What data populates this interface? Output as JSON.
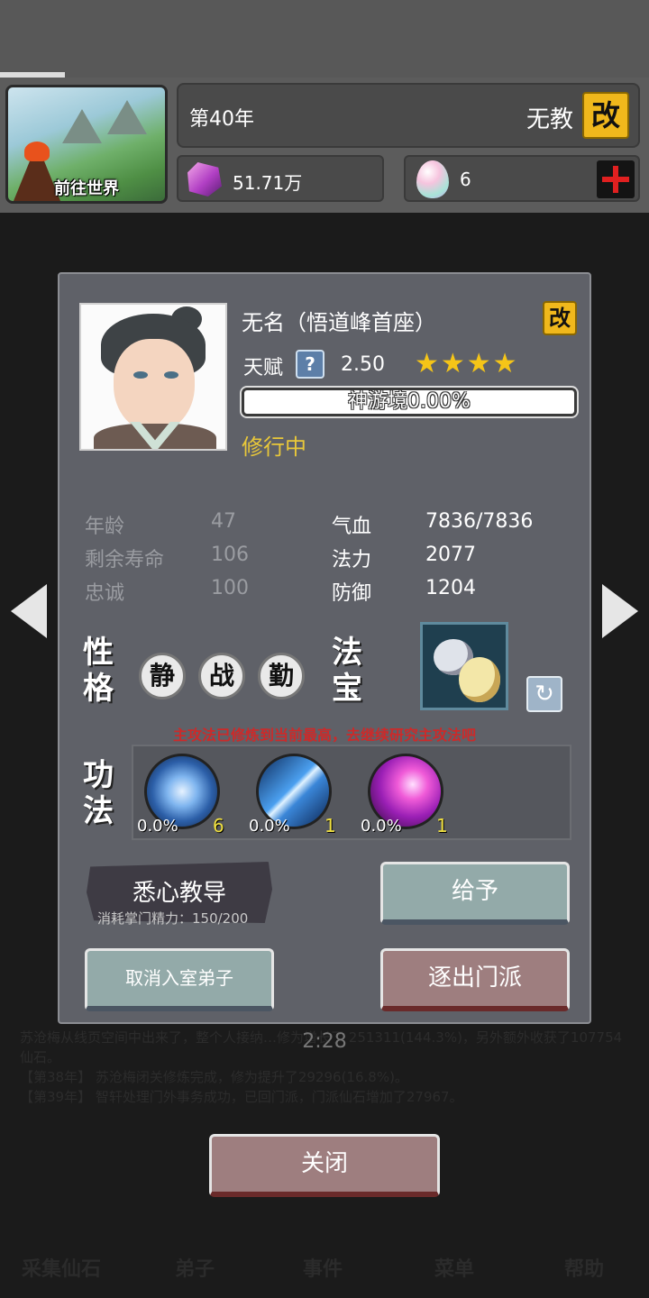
{
  "header": {
    "world_button_label": "前往世界",
    "year": "第40年",
    "sect_name": "无教",
    "rename_glyph": "改",
    "spirit_stone": "51.71万",
    "gem_count": "6"
  },
  "background": {
    "log_lines": [
      "苏沧梅从线页空间中出来了，整个人接纳…修为增长了 251311(144.3%)，另外额外收获了107754仙石。",
      "【第38年】 苏沧梅闭关修炼完成，修为提升了29296(16.8%)。",
      "【第39年】 智轩处理门外事务成功，已回门派，门派仙石增加了27967。"
    ],
    "timer": "2:28",
    "nav": [
      "采集仙石",
      "弟子",
      "事件",
      "菜单",
      "帮助"
    ]
  },
  "character": {
    "name": "无名（悟道峰首座）",
    "talent_label": "天赋",
    "talent_help": "?",
    "talent_value": "2.50",
    "stars": "★★★★",
    "star_count": 4,
    "realm_text": "神游境0.00%",
    "realm_progress": 0.0,
    "status": "修行中"
  },
  "stats": {
    "age_label": "年龄",
    "age": "47",
    "lifespan_label": "剩余寿命",
    "lifespan": "106",
    "loyalty_label": "忠诚",
    "loyalty": "100",
    "hp_label": "气血",
    "hp": "7836/7836",
    "mana_label": "法力",
    "mana": "2077",
    "defense_label": "防御",
    "defense": "1204"
  },
  "personality": {
    "label_1": "性",
    "label_2": "格",
    "traits": [
      "静",
      "战",
      "勤"
    ]
  },
  "treasure": {
    "label_1": "法",
    "label_2": "宝"
  },
  "skills": {
    "label_1": "功",
    "label_2": "法",
    "warning": "主攻法已修炼到当前最高，去继续研究主攻法吧",
    "items": [
      {
        "progress": "0.0%",
        "level": "6"
      },
      {
        "progress": "0.0%",
        "level": "1"
      },
      {
        "progress": "0.0%",
        "level": "1"
      }
    ]
  },
  "actions": {
    "teach": "悉心教导",
    "teach_cost": "消耗掌门精力：150/200",
    "give": "给予",
    "cancel_disciple": "取消入室弟子",
    "expel": "逐出门派",
    "close": "关闭"
  },
  "colors": {
    "accent_gold": "#f0b81c",
    "status_yellow": "#e9c83a",
    "warning_red": "#cc2a2a",
    "star_gold": "#f5c518"
  }
}
